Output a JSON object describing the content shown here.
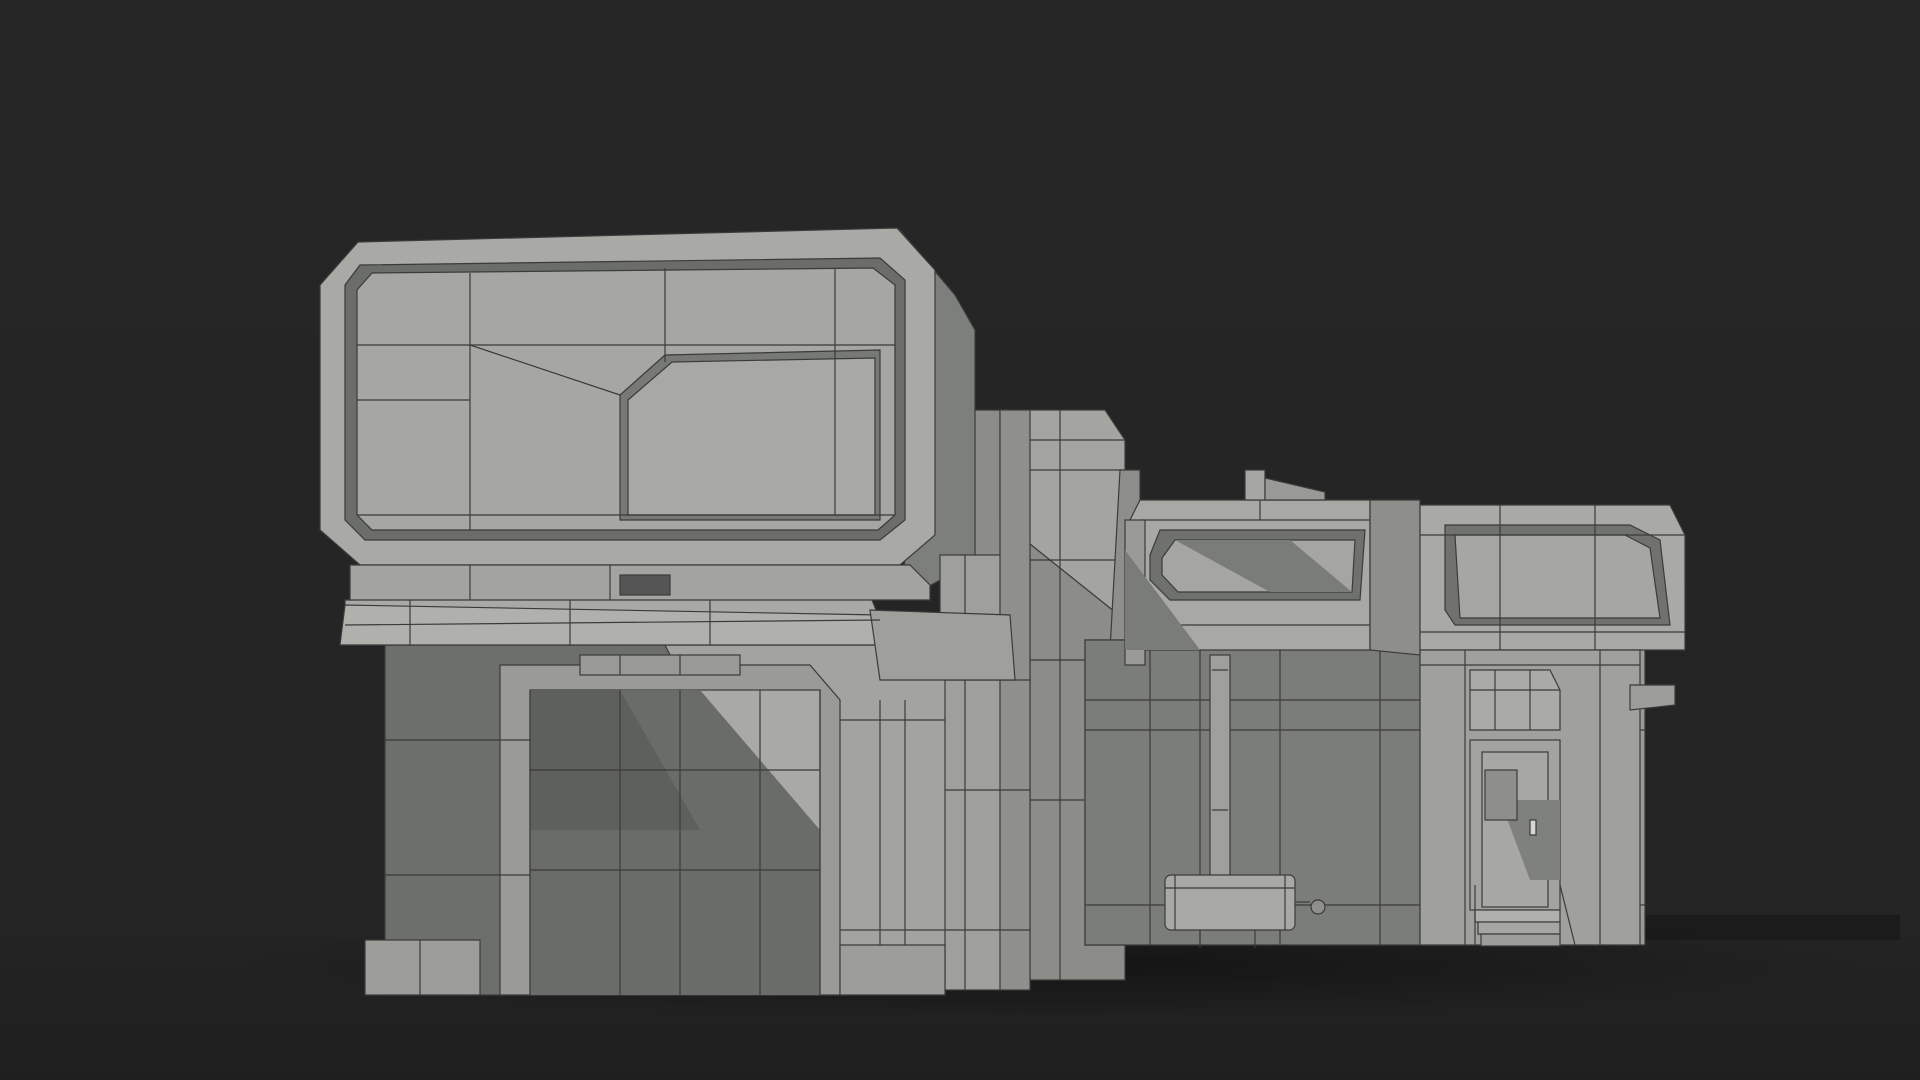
{
  "scene": {
    "subject": "building-render",
    "colors": {
      "background": "#252525",
      "floor": "#232323",
      "wall_light": "#a9aaa6",
      "wall_mid": "#979894",
      "wall_shadow": "#6e706d",
      "wall_deep": "#585a58",
      "edge_line": "#3a3b3a"
    }
  }
}
